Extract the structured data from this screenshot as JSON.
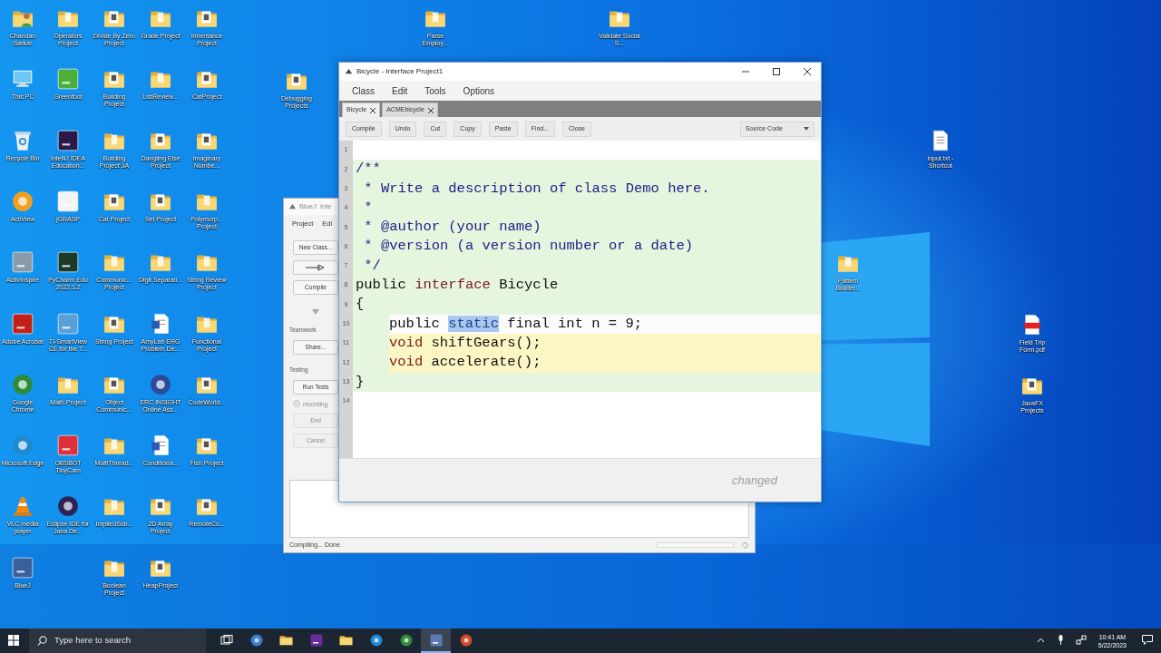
{
  "desktop": {
    "icon_columns": [
      [
        {
          "label": "Chandan Sarkar",
          "kind": "user"
        },
        {
          "label": "This PC",
          "kind": "pc"
        },
        {
          "label": "Recycle Bin",
          "kind": "bin"
        },
        {
          "label": "ActiView",
          "kind": "round-app",
          "color": "#f0a020"
        },
        {
          "label": "ActivInspire",
          "kind": "app",
          "color": "#8a9aa8"
        },
        {
          "label": "Adobe Acrobat",
          "kind": "app",
          "color": "#c4201a"
        },
        {
          "label": "Google Chrome",
          "kind": "round-app",
          "color": "#2e8b3a"
        },
        {
          "label": "Microsoft Edge",
          "kind": "round-app",
          "color": "#1f8ad0"
        },
        {
          "label": "VLC media player",
          "kind": "cone"
        },
        {
          "label": "BlueJ",
          "kind": "app",
          "color": "#3a5f9a"
        }
      ],
      [
        {
          "label": "Operators Project",
          "kind": "folder"
        },
        {
          "label": "Greenfoot",
          "kind": "app",
          "color": "#4caf3a"
        },
        {
          "label": "IntelliJ IDEA Education...",
          "kind": "app",
          "color": "#2a1a4a"
        },
        {
          "label": "jGRASP",
          "kind": "app",
          "color": "#f4f4f4"
        },
        {
          "label": "PyCharm Edu 2022.1.2",
          "kind": "app",
          "color": "#1b3a2a"
        },
        {
          "label": "TI-SmartView CE for the T...",
          "kind": "app",
          "color": "#5aa0d8"
        },
        {
          "label": "Math Project",
          "kind": "folder"
        },
        {
          "label": "OBSBOT TinyCam",
          "kind": "app",
          "color": "#e0303a"
        },
        {
          "label": "Eclipse IDE for Java De...",
          "kind": "round-app",
          "color": "#2c2255"
        }
      ],
      [
        {
          "label": "Divide By Zero Project",
          "kind": "project"
        },
        {
          "label": "Building Project",
          "kind": "project"
        },
        {
          "label": "Building Project 3A",
          "kind": "folder"
        },
        {
          "label": "Cat Project",
          "kind": "project"
        },
        {
          "label": "Communic... Project",
          "kind": "folder"
        },
        {
          "label": "String Project",
          "kind": "project"
        },
        {
          "label": "Object Communic...",
          "kind": "project"
        },
        {
          "label": "MultiThread...",
          "kind": "folder"
        },
        {
          "label": "ImpliedSub...",
          "kind": "folder"
        },
        {
          "label": "Boolean Project",
          "kind": "folder"
        }
      ],
      [
        {
          "label": "Grade Project",
          "kind": "folder"
        },
        {
          "label": "ListReview...",
          "kind": "folder"
        },
        {
          "label": "Dangling Else Project",
          "kind": "project"
        },
        {
          "label": "Set Project",
          "kind": "project"
        },
        {
          "label": "Digit Separati...",
          "kind": "folder"
        },
        {
          "label": "AmyLab ERG Problem De...",
          "kind": "word"
        },
        {
          "label": "ERC INSIGHT Online Ass...",
          "kind": "round-app",
          "color": "#2a4a9a"
        },
        {
          "label": "Conditiona...",
          "kind": "word"
        },
        {
          "label": "2D Array Project",
          "kind": "project"
        },
        {
          "label": "HeapProject",
          "kind": "project"
        }
      ],
      [
        {
          "label": "Inheritance Project",
          "kind": "project"
        },
        {
          "label": "CatProject",
          "kind": "project"
        },
        {
          "label": "Imaginary Numbe...",
          "kind": "project"
        },
        {
          "label": "Polymorp... Project",
          "kind": "folder"
        },
        {
          "label": "String Review Project",
          "kind": "folder"
        },
        {
          "label": "Functional Project",
          "kind": "folder"
        },
        {
          "label": "CodeWorld...",
          "kind": "project"
        },
        {
          "label": "Fish Project",
          "kind": "project"
        },
        {
          "label": "RemoteCo...",
          "kind": "project"
        }
      ]
    ],
    "loose_icons": [
      {
        "label": "Debugging Projects",
        "kind": "project"
      },
      {
        "label": "Parse Employ...",
        "kind": "folder"
      },
      {
        "label": "Validate Social S...",
        "kind": "folder"
      },
      {
        "label": "input.txt - Shortcut",
        "kind": "text"
      },
      {
        "label": "Pattern Builder...",
        "kind": "folder"
      },
      {
        "label": "Field Trip Form.pdf",
        "kind": "pdf"
      },
      {
        "label": "JavaFX Projects",
        "kind": "project"
      }
    ]
  },
  "back_window": {
    "title": "BlueJ: Inte",
    "menu": [
      "Project",
      "Edi"
    ],
    "panel": [
      {
        "kind": "button",
        "label": "New Class...",
        "disabled": false
      },
      {
        "kind": "arrow-button",
        "disabled": false
      },
      {
        "kind": "button",
        "label": "Compile",
        "disabled": false
      },
      {
        "kind": "collapse"
      },
      {
        "kind": "heading",
        "label": "Teamwork"
      },
      {
        "kind": "button",
        "label": "Share...",
        "disabled": false
      },
      {
        "kind": "heading",
        "label": "Testing"
      },
      {
        "kind": "button",
        "label": "Run Tests",
        "disabled": false
      },
      {
        "kind": "radio",
        "label": "recording",
        "checked": false
      },
      {
        "kind": "button",
        "label": "End",
        "disabled": true
      },
      {
        "kind": "button",
        "label": "Cancel",
        "disabled": true
      }
    ],
    "progress": {
      "level": 0
    },
    "status": "Compiling... Done."
  },
  "editor": {
    "title": "Bicycle - Interface Project1",
    "menu": [
      "Class",
      "Edit",
      "Tools",
      "Options"
    ],
    "tabs": [
      {
        "label": "Bicycle",
        "selected": true
      },
      {
        "label": "ACMEbicycle",
        "selected": false
      }
    ],
    "toolbar": [
      "Compile",
      "Undo",
      "Cut",
      "Copy",
      "Paste",
      "Find...",
      "Close"
    ],
    "view_select": "Source Code",
    "lines": [
      {
        "number": "1",
        "kind": "plain"
      },
      {
        "number": "2",
        "kind": "class",
        "tokens": [
          {
            "kind": "comment",
            "text": "/**"
          }
        ]
      },
      {
        "number": "3",
        "kind": "class",
        "tokens": [
          {
            "kind": "comment",
            "text": " * Write a description of class Demo here."
          }
        ]
      },
      {
        "number": "4",
        "kind": "class",
        "tokens": [
          {
            "kind": "comment",
            "text": " *"
          }
        ]
      },
      {
        "number": "5",
        "kind": "class",
        "tokens": [
          {
            "kind": "comment",
            "text": " * @author (your name)"
          }
        ]
      },
      {
        "number": "6",
        "kind": "class",
        "tokens": [
          {
            "kind": "comment",
            "text": " * @version (a version number or a date)"
          }
        ]
      },
      {
        "number": "7",
        "kind": "class",
        "tokens": [
          {
            "kind": "comment",
            "text": " */"
          }
        ]
      },
      {
        "number": "8",
        "kind": "class",
        "tokens": [
          {
            "kind": "plain",
            "text": "public "
          },
          {
            "kind": "keyword",
            "text": "interface"
          },
          {
            "kind": "plain",
            "text": " Bicycle"
          }
        ]
      },
      {
        "number": "9",
        "kind": "class",
        "tokens": [
          {
            "kind": "plain",
            "text": "{"
          }
        ]
      },
      {
        "number": "10",
        "kind": "current",
        "indented": true,
        "tokens": [
          {
            "kind": "plain",
            "text": "public "
          },
          {
            "kind": "selection",
            "text": "static"
          },
          {
            "kind": "plain",
            "text": " final int n = 9;"
          }
        ]
      },
      {
        "number": "11",
        "kind": "method",
        "indented": true,
        "tokens": [
          {
            "kind": "keyword",
            "text": "void"
          },
          {
            "kind": "plain",
            "text": " shiftGears();"
          }
        ]
      },
      {
        "number": "12",
        "kind": "method",
        "indented": true,
        "tokens": [
          {
            "kind": "keyword",
            "text": "void"
          },
          {
            "kind": "plain",
            "text": " accelerate();"
          }
        ]
      },
      {
        "number": "13",
        "kind": "class",
        "tokens": [
          {
            "kind": "plain",
            "text": "}"
          }
        ]
      },
      {
        "number": "14",
        "kind": "plain"
      }
    ],
    "status": "changed"
  },
  "taskbar": {
    "search_placeholder": "Type here to search",
    "apps": [
      {
        "kind": "taskview",
        "active": false
      },
      {
        "kind": "round",
        "color": "#3a7bd5",
        "active": false
      },
      {
        "kind": "folder",
        "active": false
      },
      {
        "kind": "square",
        "color": "#6a2a9a",
        "active": false
      },
      {
        "kind": "folder",
        "active": false
      },
      {
        "kind": "round",
        "color": "#1f8ad0",
        "active": false
      },
      {
        "kind": "round",
        "color": "#2e8b3a",
        "active": false
      },
      {
        "kind": "square",
        "color": "#5a7ab0",
        "active": true
      },
      {
        "kind": "round",
        "color": "#d04a2a",
        "active": false
      }
    ],
    "time": "10:41 AM",
    "date": "5/22/2023"
  }
}
